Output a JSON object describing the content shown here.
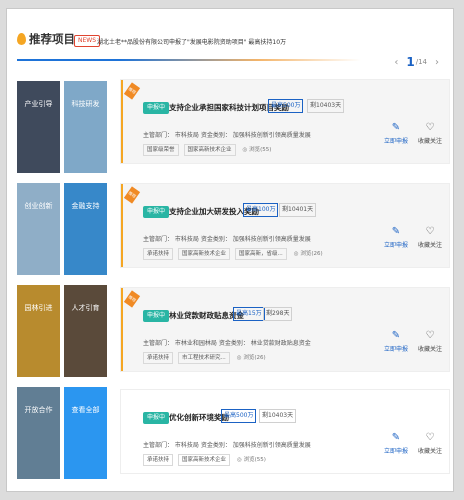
{
  "header": {
    "title": "推荐项目",
    "news_badge": "NEWS",
    "news_text": "湖北土老**品股份有限公司申报了\"发展电影院资助项目\" 最高扶持10万",
    "pager": {
      "prev": "‹",
      "current": "1",
      "total": "/14",
      "next": "›"
    }
  },
  "categories": [
    {
      "label": "产业引导",
      "color": "#3f4a5c"
    },
    {
      "label": "科技研发",
      "color": "#7fa8c8"
    },
    {
      "label": "创业创新",
      "color": "#8faec7"
    },
    {
      "label": "金融支持",
      "color": "#3788c9"
    },
    {
      "label": "园林引进",
      "color": "#b88b2e"
    },
    {
      "label": "人才引育",
      "color": "#5a4a3a"
    },
    {
      "label": "开放合作",
      "color": "#617e94"
    },
    {
      "label": "查看全部",
      "color": "#2b96f0"
    }
  ],
  "projects": [
    {
      "ribbon": "推荐",
      "status": "申报中",
      "title": "支持企业承担国家科技计划项目奖励",
      "amount": "最高500万",
      "days_left": "剩10403天",
      "meta": "主管部门：  市科技局      资金类别：  加强科技创新引领高质量发展",
      "tags": [
        "国家级荣誉",
        "国家高新技术企业"
      ],
      "views": "浏览(55)",
      "apply_label": "立即申报",
      "fav_label": "收藏关注"
    },
    {
      "ribbon": "推荐",
      "status": "申报中",
      "title": "支持企业加大研发投入奖励",
      "amount": "最高100万",
      "days_left": "剩10401天",
      "meta": "主管部门：  市科技局      资金类别：  加强科技创新引领高质量发展",
      "tags": [
        "承诺扶持",
        "国家高新技术企业",
        "国家高新，省级..."
      ],
      "views": "浏览(26)",
      "apply_label": "立即申报",
      "fav_label": "收藏关注"
    },
    {
      "ribbon": "推荐",
      "status": "申报中",
      "title": "林业贷款财政贴息资金",
      "amount": "最高15万",
      "days_left": "剩298天",
      "meta": "主管部门：  市林业和园林局      资金类别：  林业贷款财政贴息资金",
      "tags": [
        "承诺扶持",
        "市工程技术研究..."
      ],
      "views": "浏览(26)",
      "apply_label": "立即申报",
      "fav_label": "收藏关注"
    },
    {
      "ribbon": "",
      "status": "申报中",
      "title": "优化创新环境奖励",
      "amount": "最高500万",
      "days_left": "剩10403天",
      "meta": "主管部门：  市科技局      资金类别：  加强科技创新引领高质量发展",
      "tags": [
        "承诺扶持",
        "国家高新技术企业"
      ],
      "views": "浏览(55)",
      "apply_label": "立即申报",
      "fav_label": "收藏关注"
    }
  ],
  "icons": {
    "apply": "edit-icon",
    "fav": "heart-icon",
    "views": "eye-icon",
    "title": "fire-icon"
  }
}
